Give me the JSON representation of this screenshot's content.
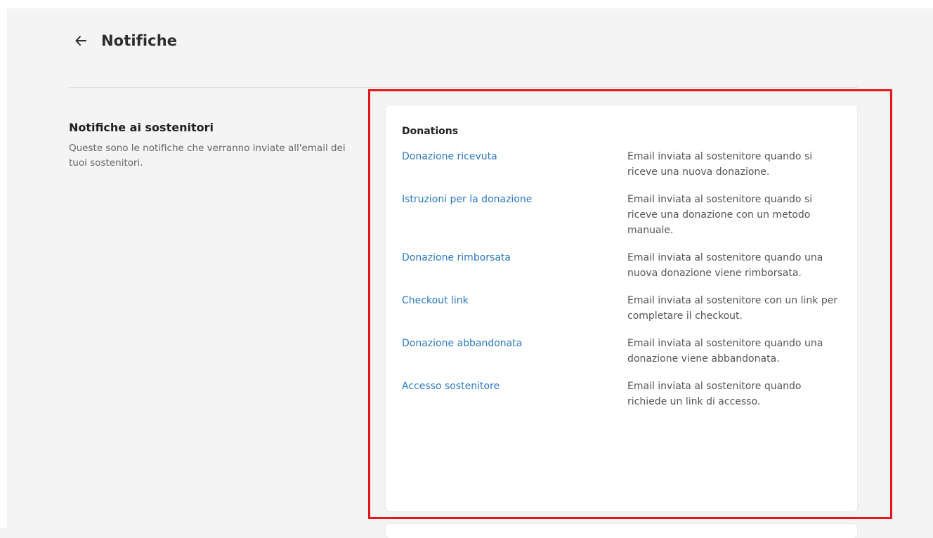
{
  "header": {
    "title": "Notifiche",
    "back_icon": "arrow-left-icon"
  },
  "section": {
    "title": "Notifiche ai sostenitori",
    "description": "Queste sono le notifiche che verranno inviate all'email dei tuoi sostenitori."
  },
  "card": {
    "title": "Donations",
    "items": [
      {
        "label": "Donazione ricevuta",
        "description": "Email inviata al sostenitore quando si riceve una nuova donazione."
      },
      {
        "label": "Istruzioni per la donazione",
        "description": "Email inviata al sostenitore quando si riceve una donazione con un metodo manuale."
      },
      {
        "label": "Donazione rimborsata",
        "description": "Email inviata al sostenitore quando una nuova donazione viene rimborsata."
      },
      {
        "label": "Checkout link",
        "description": "Email inviata al sostenitore con un link per completare il checkout."
      },
      {
        "label": "Donazione abbandonata",
        "description": "Email inviata al sostenitore quando una donazione viene abbandonata."
      },
      {
        "label": "Accesso sostenitore",
        "description": "Email inviata al sostenitore quando richiede un link di accesso."
      }
    ]
  },
  "colors": {
    "background": "#f4f4f4",
    "link": "#2b78c2",
    "highlight": "#e8141c"
  }
}
